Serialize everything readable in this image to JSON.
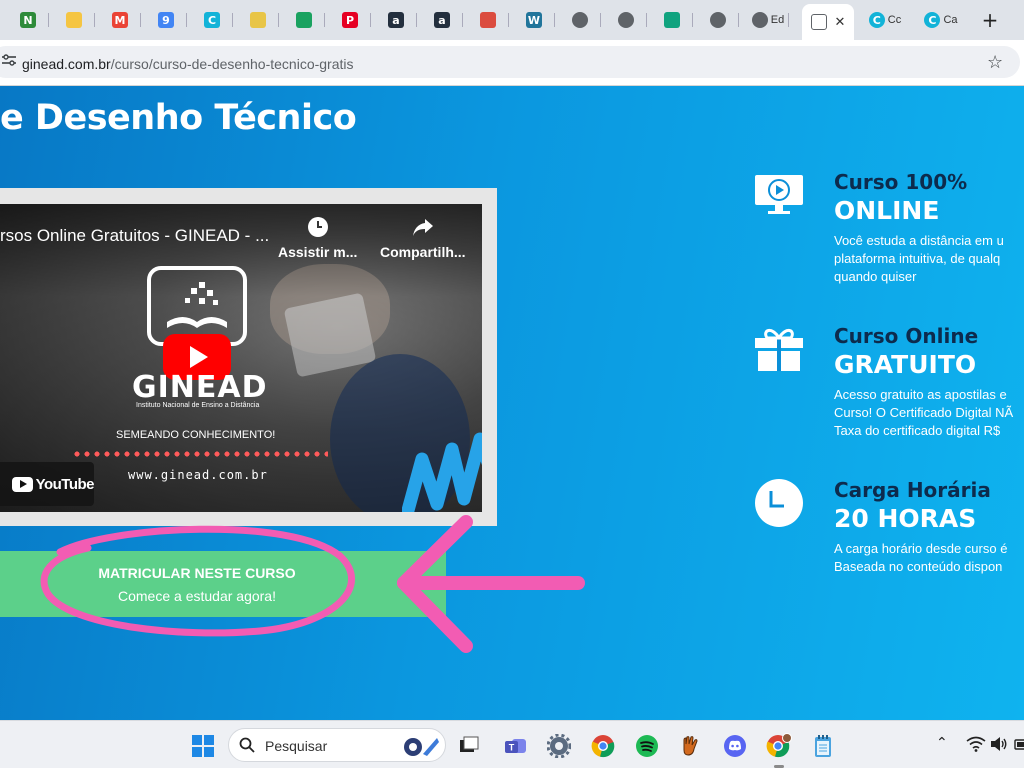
{
  "browser": {
    "tabs": [
      {
        "icon": "notion-icon",
        "letter": "N",
        "color": "#2e8b3a"
      },
      {
        "icon": "bulb-icon",
        "letter": "",
        "color": "#f5c542"
      },
      {
        "icon": "gmail-icon",
        "letter": "M",
        "color": "#ea4335"
      },
      {
        "icon": "calendar-icon",
        "letter": "9",
        "color": "#4285f4"
      },
      {
        "icon": "canva-icon",
        "letter": "C",
        "color": "#12b3d8"
      },
      {
        "icon": "notes-icon",
        "letter": "",
        "color": "#e8c547"
      },
      {
        "icon": "sheets-icon",
        "letter": "",
        "color": "#1aa260"
      },
      {
        "icon": "pinterest-icon",
        "letter": "P",
        "color": "#e60023"
      },
      {
        "icon": "amazon-icon",
        "letter": "a",
        "color": "#232f3e"
      },
      {
        "icon": "amazon-icon",
        "letter": "a",
        "color": "#232f3e"
      },
      {
        "icon": "todoist-icon",
        "letter": "",
        "color": "#db4c3f"
      },
      {
        "icon": "wordpress-icon",
        "letter": "W",
        "color": "#21759b"
      },
      {
        "icon": "globe-icon",
        "letter": "",
        "color": "#5f6368"
      },
      {
        "icon": "globe-icon",
        "letter": "",
        "color": "#5f6368"
      },
      {
        "icon": "chatgpt-icon",
        "letter": "",
        "color": "#10a37f"
      },
      {
        "icon": "globe-icon",
        "letter": "",
        "color": "#5f6368"
      },
      {
        "icon": "globe-icon",
        "letter": "",
        "color": "#5f6368",
        "title": "Ed"
      }
    ],
    "active_tab": {
      "icon": "site-icon",
      "close": "✕"
    },
    "trailing_tabs": [
      {
        "icon": "canva-icon",
        "letter": "C",
        "color": "#12b3d8",
        "title": "Cc"
      },
      {
        "icon": "canva-icon",
        "letter": "C",
        "color": "#12b3d8",
        "title": "Ca"
      }
    ],
    "new_tab_label": "+",
    "url_host": "ginead.com.br",
    "url_path": "/curso/curso-de-desenho-tecnico-gratis"
  },
  "page": {
    "title": "e Desenho Técnico",
    "video": {
      "title": "rsos Online Gratuitos - GINEAD - ...",
      "watch_later": "Assistir m...",
      "share": "Compartilh...",
      "brand": "GINEAD",
      "brand_sub": "Instituto Nacional de Ensino a Distância",
      "slogan": "SEMEANDO CONHECIMENTO!",
      "site": "www.ginead.com.br",
      "youtube_label": "YouTube"
    },
    "enroll": {
      "main": "MATRICULAR NESTE CURSO",
      "sub": "Comece a estudar agora!"
    },
    "features": [
      {
        "icon": "monitor-play-icon",
        "h1": "Curso 100%",
        "h2": "ONLINE",
        "lines": [
          "Você estuda a distância em u",
          "plataforma intuitiva, de qualq",
          "quando quiser"
        ]
      },
      {
        "icon": "gift-icon",
        "h1": "Curso Online",
        "h2": "GRATUITO",
        "lines": [
          "Acesso gratuito as apostilas e",
          "Curso! O Certificado Digital NÃ",
          "Taxa do certificado digital R$"
        ]
      },
      {
        "icon": "clock-icon",
        "h1": "Carga Horária",
        "h2": "20 HORAS",
        "lines": [
          "A carga horário desde curso é",
          "Baseada no conteúdo dispon"
        ]
      }
    ],
    "annotation_color": "#f25cb3",
    "enroll_color": "#5cd08a"
  },
  "taskbar": {
    "search_placeholder": "Pesquisar",
    "apps": [
      "start-icon",
      "task-view-icon",
      "teams-icon",
      "settings-icon",
      "chrome-icon",
      "spotify-icon",
      "glove-icon",
      "discord-icon",
      "chrome-profile-icon",
      "notepad-icon"
    ]
  }
}
